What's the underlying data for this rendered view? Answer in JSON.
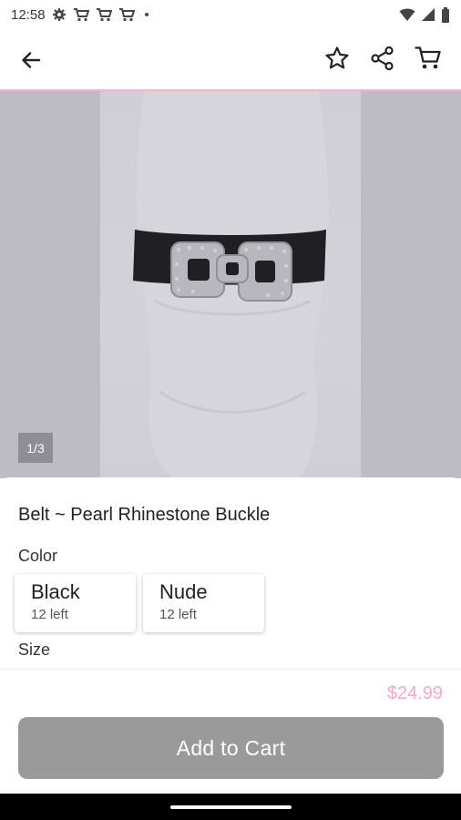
{
  "status_bar": {
    "time": "12:58",
    "icons": [
      "settings-icon",
      "cart-notification-icon",
      "cart-notification-icon",
      "cart-notification-icon",
      "dot-icon"
    ],
    "right_icons": [
      "wifi-icon",
      "signal-icon",
      "battery-icon"
    ]
  },
  "top_bar": {
    "icons": [
      "back-arrow-icon",
      "star-icon",
      "share-icon",
      "cart-icon"
    ]
  },
  "image": {
    "indicator": "1/3"
  },
  "product": {
    "title": "Belt ~ Pearl Rhinestone Buckle",
    "color_label": "Color",
    "colors": [
      {
        "name": "Black",
        "stock": "12 left"
      },
      {
        "name": "Nude",
        "stock": "12 left"
      }
    ],
    "size_label": "Size"
  },
  "footer": {
    "price": "$24.99",
    "add_to_cart": "Add to Cart"
  },
  "theme": {
    "accent_pink": "#f5a9cf",
    "button_gray": "#9a9a9a"
  }
}
